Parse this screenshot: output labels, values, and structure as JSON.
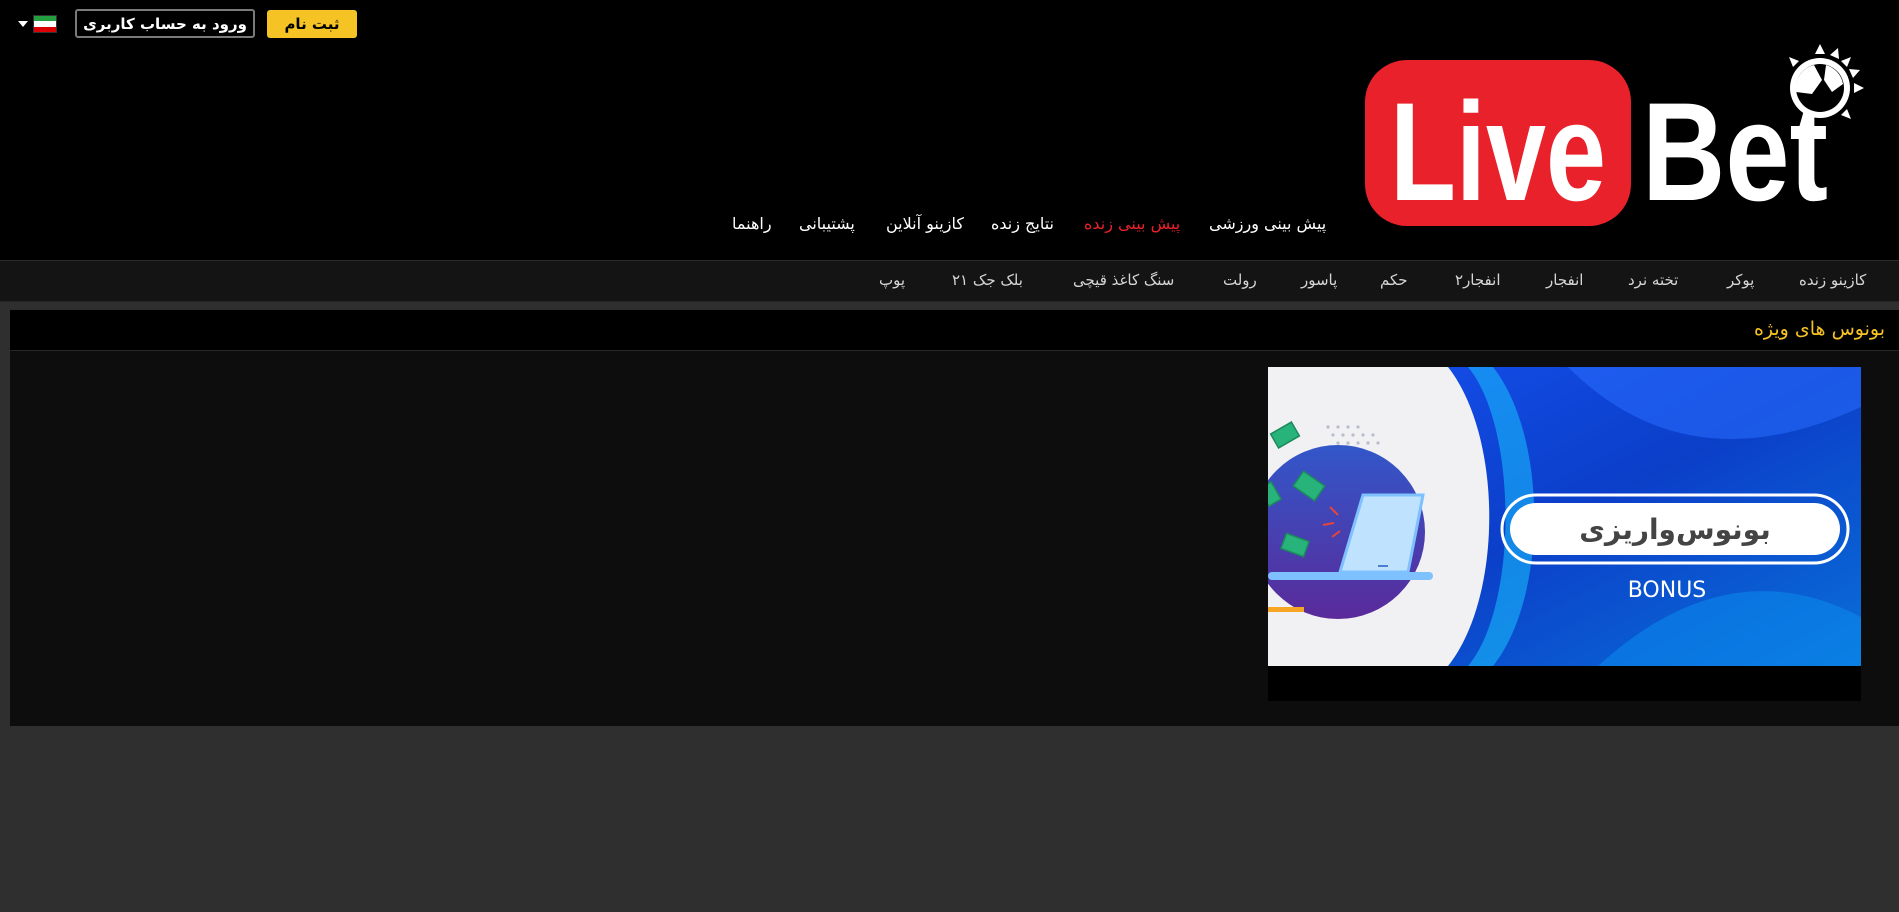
{
  "header": {
    "register_label": "ثبت نام",
    "login_label": "ورود به حساب کاربری",
    "language": {
      "flag_colors": [
        "#239f40",
        "#ffffff",
        "#da0000"
      ]
    },
    "logo": {
      "word_live": "Live",
      "word_bet": "Bet",
      "brand_red": "#e8212a"
    }
  },
  "main_nav": {
    "items": [
      {
        "label": "پیش بینی ورزشی"
      },
      {
        "label": "پیش بینی زنده",
        "active": true
      },
      {
        "label": "نتایج زنده"
      },
      {
        "label": "کازینو آنلاین"
      },
      {
        "label": "پشتیبانی"
      },
      {
        "label": "راهنما"
      }
    ]
  },
  "casino_nav": {
    "items": [
      {
        "label": "کازینو زنده"
      },
      {
        "label": "پوکر"
      },
      {
        "label": "تخته نرد"
      },
      {
        "label": "انفجار"
      },
      {
        "label": "انفجار۲"
      },
      {
        "label": "حکم"
      },
      {
        "label": "پاسور"
      },
      {
        "label": "رولت"
      },
      {
        "label": "سنگ کاغذ قیچی"
      },
      {
        "label": "بلک جک ۲۱"
      },
      {
        "label": "پوپ"
      }
    ]
  },
  "bonus_section": {
    "title": "بونوس های ویژه",
    "banner": {
      "title": "بونوس‌واریزی",
      "subtitle": "BONUS"
    }
  },
  "colors": {
    "accent_yellow": "#f6c324",
    "active_red": "#e8212a",
    "header_bg": "#000000",
    "page_bg": "#2f2f2f"
  }
}
